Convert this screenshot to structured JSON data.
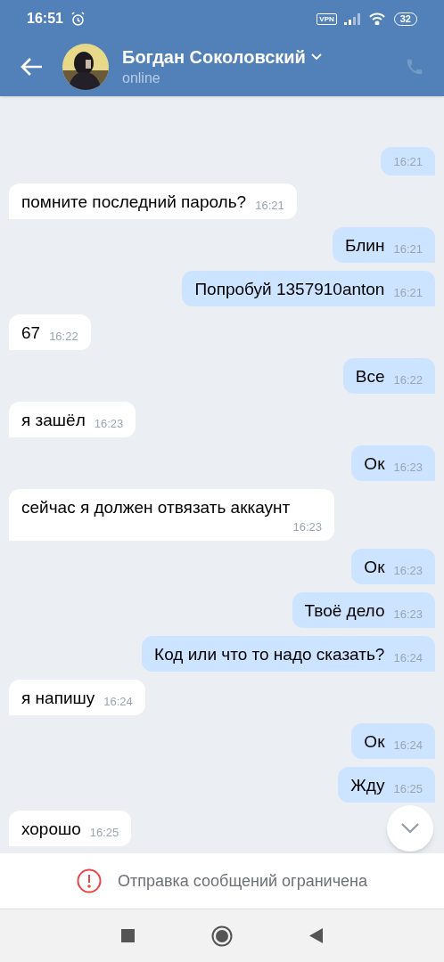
{
  "status_bar": {
    "time": "16:51",
    "vpn": "VPN",
    "battery": "32"
  },
  "header": {
    "name": "Богдан Соколовский",
    "status": "online"
  },
  "messages": [
    {
      "kind": "outgoing",
      "time": "16:21"
    },
    {
      "kind": "incoming",
      "text": "помните последний пароль?",
      "time": "16:21"
    },
    {
      "kind": "outgoing",
      "text": "Блин",
      "time": "16:21"
    },
    {
      "kind": "outgoing",
      "text": "Попробуй 1357910anton",
      "time": "16:21"
    },
    {
      "kind": "incoming",
      "text": "67",
      "time": "16:22"
    },
    {
      "kind": "outgoing",
      "text": "Все",
      "time": "16:22"
    },
    {
      "kind": "incoming",
      "text": "я зашёл",
      "time": "16:23"
    },
    {
      "kind": "outgoing",
      "text": "Ок",
      "time": "16:23"
    },
    {
      "kind": "incoming",
      "text": "сейчас я должен отвязать аккаунт",
      "time": "16:23"
    },
    {
      "kind": "outgoing",
      "text": "Ок",
      "time": "16:23"
    },
    {
      "kind": "outgoing",
      "text": "Твоё дело",
      "time": "16:23"
    },
    {
      "kind": "outgoing",
      "text": "Код или что то надо сказать?",
      "time": "16:24"
    },
    {
      "kind": "incoming",
      "text": "я напишу",
      "time": "16:24"
    },
    {
      "kind": "outgoing",
      "text": "Ок",
      "time": "16:24"
    },
    {
      "kind": "outgoing",
      "text": "Жду",
      "time": "16:25"
    },
    {
      "kind": "incoming",
      "text": "хорошо",
      "time": "16:25"
    }
  ],
  "notice": "Отправка сообщений ограничена"
}
